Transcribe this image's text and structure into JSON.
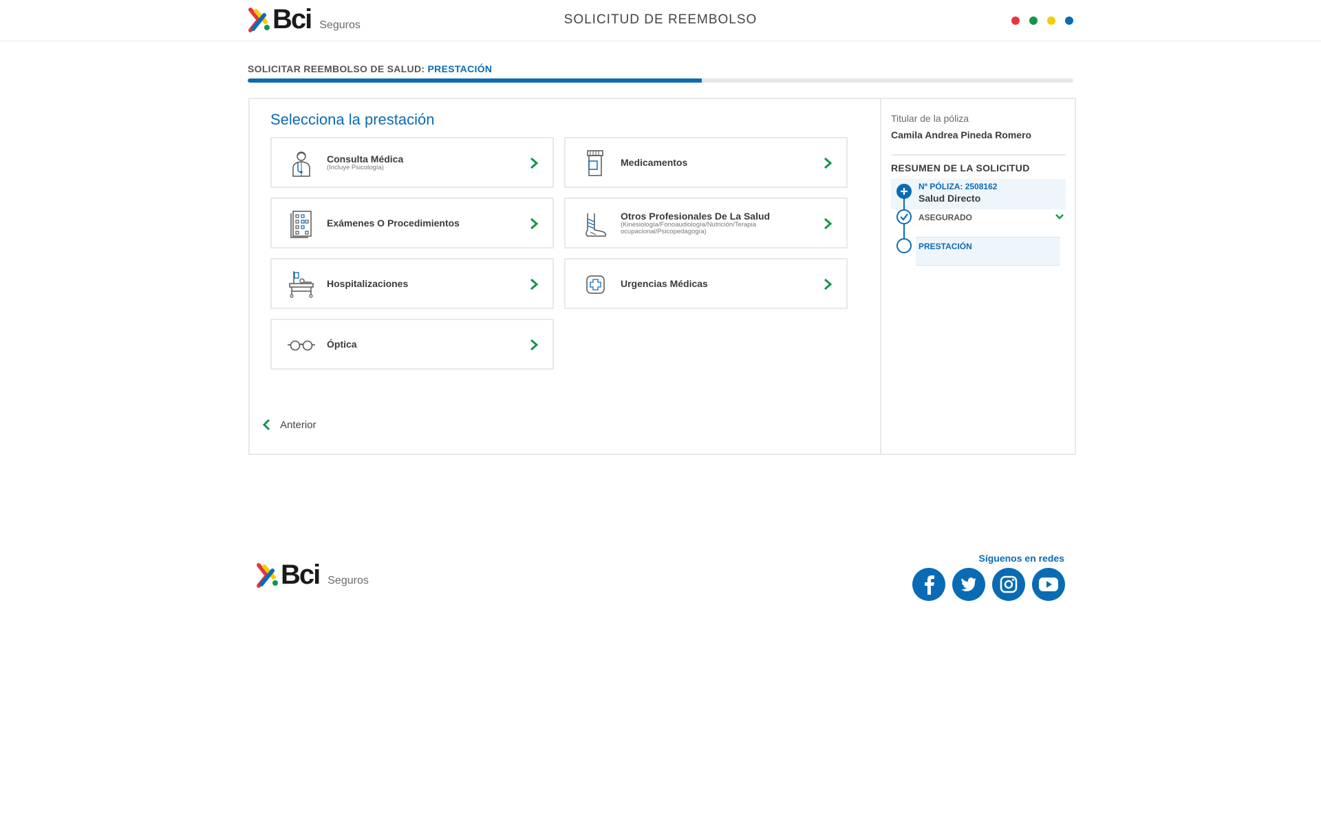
{
  "header": {
    "brand": "Bci",
    "brand_sub": "Seguros",
    "title": "SOLICITUD DE REEMBOLSO",
    "dot_colors": [
      "#e8343f",
      "#10954a",
      "#f5cc00",
      "#0a6bb5"
    ]
  },
  "progress": {
    "label_prefix": "SOLICITAR REEMBOLSO DE SALUD:",
    "label_current": "PRESTACIÓN",
    "fraction": 0.55
  },
  "main": {
    "title": "Selecciona la prestación",
    "cards": [
      {
        "title": "Consulta Médica",
        "subtitle": "(Incluye Psicología)",
        "icon": "doctor-icon"
      },
      {
        "title": "Medicamentos",
        "subtitle": "",
        "icon": "medicine-bottle-icon"
      },
      {
        "title": "Exámenes O Procedimientos",
        "subtitle": "",
        "icon": "lab-report-icon"
      },
      {
        "title": "Otros Profesionales De La Salud",
        "subtitle": "(Kinesiología/Fonoaudiología/Nutrición/Terapia ocupacional/Psicopedagogía)",
        "icon": "bandaged-foot-icon"
      },
      {
        "title": "Hospitalizaciones",
        "subtitle": "",
        "icon": "hospital-bed-icon"
      },
      {
        "title": "Urgencias Médicas",
        "subtitle": "",
        "icon": "emergency-cross-icon"
      },
      {
        "title": "Óptica",
        "subtitle": "",
        "icon": "glasses-icon"
      }
    ],
    "back_label": "Anterior"
  },
  "sidebar": {
    "holder_label": "Titular de la póliza",
    "holder_name": "Camila Andrea Pineda Romero",
    "summary_title": "RESUMEN DE LA SOLICITUD",
    "steps": [
      {
        "line1": "Nº PÓLIZA: 2508162",
        "line2": "Salud Directo"
      },
      {
        "line1": "ASEGURADO"
      },
      {
        "line1": "PRESTACIÓN"
      }
    ]
  },
  "footer": {
    "brand": "Bci",
    "brand_sub": "Seguros",
    "follow_label": "Síguenos en redes",
    "socials": [
      "facebook-icon",
      "twitter-icon",
      "instagram-icon",
      "youtube-icon"
    ]
  },
  "colors": {
    "primary": "#0a6bb5",
    "chevron": "#10954a"
  }
}
